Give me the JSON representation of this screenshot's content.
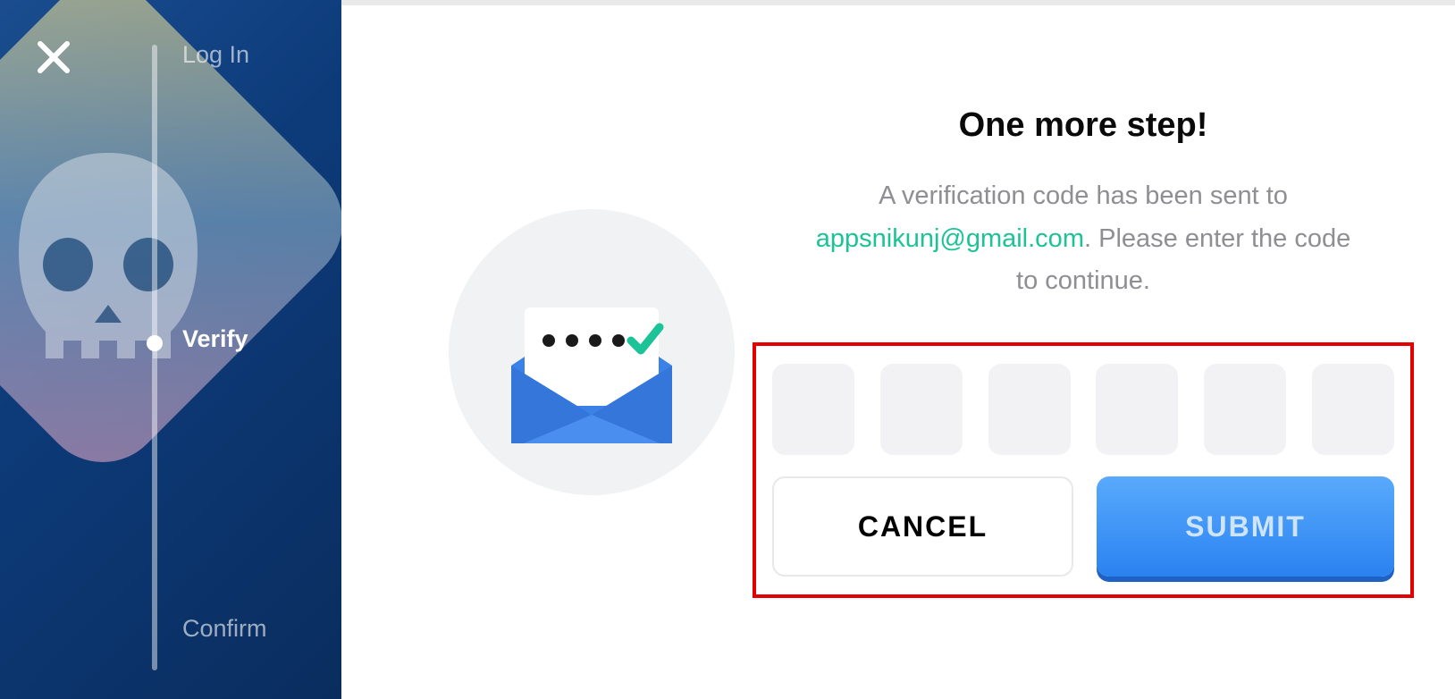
{
  "sidebar": {
    "steps": {
      "login": "Log In",
      "verify": "Verify",
      "confirm": "Confirm"
    }
  },
  "main": {
    "title": "One more step!",
    "desc_prefix": "A verification code has been sent to ",
    "email": "appsnikunj@gmail.com",
    "desc_suffix": ". Please enter the code to continue.",
    "buttons": {
      "cancel": "CANCEL",
      "submit": "SUBMIT"
    }
  },
  "colors": {
    "accent": "#1bc396",
    "primary": "#2a82f0",
    "highlight_border": "#e50000"
  },
  "icons": {
    "close": "close-icon",
    "envelope": "mail-envelope-icon",
    "check": "checkmark-icon",
    "skull": "game-skull-icon"
  }
}
